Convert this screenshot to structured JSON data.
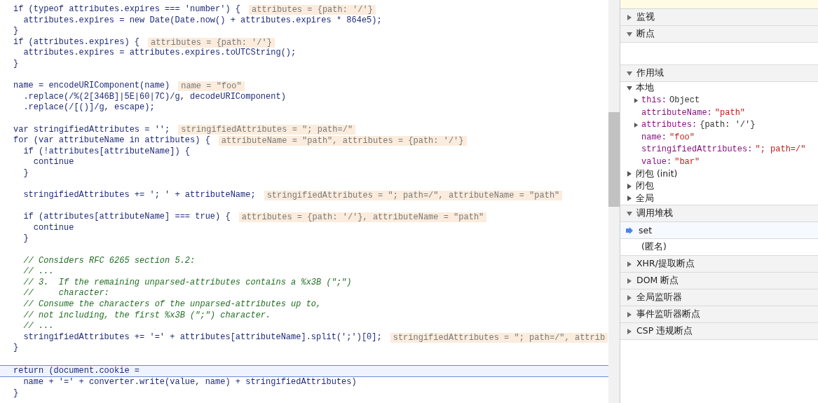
{
  "code_lines": [
    {
      "kind": "code",
      "text": "if (typeof attributes.expires === 'number') {",
      "inline_value": "attributes = {path: '/'}",
      "current": false
    },
    {
      "kind": "code",
      "text": "  attributes.expires = new Date(Date.now() + attributes.expires * 864e5);",
      "current": false
    },
    {
      "kind": "code",
      "text": "}",
      "current": false
    },
    {
      "kind": "code",
      "text": "if (attributes.expires) {",
      "inline_value": "attributes = {path: '/'}",
      "current": false
    },
    {
      "kind": "code",
      "text": "  attributes.expires = attributes.expires.toUTCString();",
      "current": false
    },
    {
      "kind": "code",
      "text": "}",
      "current": false
    },
    {
      "kind": "blank",
      "current": false
    },
    {
      "kind": "code",
      "text": "name = encodeURIComponent(name)",
      "inline_value": "name = \"foo\"",
      "current": false
    },
    {
      "kind": "code",
      "text": "  .replace(/%(2[346B]|5E|60|7C)/g, decodeURIComponent)",
      "current": false
    },
    {
      "kind": "code",
      "text": "  .replace(/[()]/g, escape);",
      "current": false
    },
    {
      "kind": "blank",
      "current": false
    },
    {
      "kind": "code",
      "text": "var stringifiedAttributes = '';",
      "inline_value": "stringifiedAttributes = \"; path=/\"",
      "current": false
    },
    {
      "kind": "code",
      "text": "for (var attributeName in attributes) {",
      "inline_value": "attributeName = \"path\", attributes = {path: '/'}",
      "current": false
    },
    {
      "kind": "code",
      "text": "  if (!attributes[attributeName]) {",
      "current": false
    },
    {
      "kind": "code",
      "text": "    continue",
      "current": false
    },
    {
      "kind": "code",
      "text": "  }",
      "current": false
    },
    {
      "kind": "blank",
      "current": false
    },
    {
      "kind": "code",
      "text": "  stringifiedAttributes += '; ' + attributeName;",
      "inline_value": "stringifiedAttributes = \"; path=/\", attributeName = \"path\"",
      "current": false
    },
    {
      "kind": "blank",
      "current": false
    },
    {
      "kind": "code",
      "text": "  if (attributes[attributeName] === true) {",
      "inline_value": "attributes = {path: '/'}, attributeName = \"path\"",
      "current": false
    },
    {
      "kind": "code",
      "text": "    continue",
      "current": false
    },
    {
      "kind": "code",
      "text": "  }",
      "current": false
    },
    {
      "kind": "blank",
      "current": false
    },
    {
      "kind": "comment",
      "text": "  // Considers RFC 6265 section 5.2:",
      "current": false
    },
    {
      "kind": "comment",
      "text": "  // ...",
      "current": false
    },
    {
      "kind": "comment",
      "text": "  // 3.  If the remaining unparsed-attributes contains a %x3B (\";\")",
      "current": false
    },
    {
      "kind": "comment",
      "text": "  //     character:",
      "current": false
    },
    {
      "kind": "comment",
      "text": "  // Consume the characters of the unparsed-attributes up to,",
      "current": false
    },
    {
      "kind": "comment",
      "text": "  // not including, the first %x3B (\";\") character.",
      "current": false
    },
    {
      "kind": "comment",
      "text": "  // ...",
      "current": false
    },
    {
      "kind": "code",
      "text": "  stringifiedAttributes += '=' + attributes[attributeName].split(';')[0];",
      "inline_value": "stringifiedAttributes = \"; path=/\", attrib",
      "current": false
    },
    {
      "kind": "code",
      "text": "}",
      "current": false
    },
    {
      "kind": "blank",
      "current": false
    },
    {
      "kind": "code",
      "text": "return (document.cookie =",
      "current": true
    },
    {
      "kind": "code",
      "text": "  name + '=' + converter.write(value, name) + stringifiedAttributes)",
      "current": false
    },
    {
      "kind": "code",
      "text": "}",
      "current": false
    }
  ],
  "sidebar": {
    "sections": [
      {
        "kind": "header",
        "title": "监视",
        "expanded": false
      },
      {
        "kind": "header",
        "title": "断点",
        "expanded": true
      },
      {
        "kind": "empty"
      },
      {
        "kind": "header",
        "title": "作用域",
        "expanded": true
      },
      {
        "kind": "scope",
        "title": "本地",
        "expanded": true,
        "properties": [
          {
            "name": "this:",
            "value": "Object",
            "color": "#333333",
            "expandable": true
          },
          {
            "name": "attributeName:",
            "value": "\"path\"",
            "color": "#c41a16",
            "expandable": false
          },
          {
            "name": "attributes:",
            "value": "{path: '/'}",
            "color": "#333333",
            "expandable": true
          },
          {
            "name": "name:",
            "value": "\"foo\"",
            "color": "#c41a16",
            "expandable": false
          },
          {
            "name": "stringifiedAttributes:",
            "value": "\"; path=/\"",
            "color": "#c41a16",
            "expandable": false
          },
          {
            "name": "value:",
            "value": "\"bar\"",
            "color": "#c41a16",
            "expandable": false
          }
        ]
      },
      {
        "kind": "scope",
        "title": "闭包 (init)",
        "expanded": false
      },
      {
        "kind": "scope",
        "title": "闭包",
        "expanded": false
      },
      {
        "kind": "scope",
        "title": "全局",
        "expanded": false
      },
      {
        "kind": "header",
        "title": "调用堆栈",
        "expanded": true
      },
      {
        "kind": "frame",
        "title": "set",
        "current": true
      },
      {
        "kind": "frame",
        "title": "(匿名)",
        "current": false
      },
      {
        "kind": "header",
        "title": "XHR/提取断点",
        "expanded": false
      },
      {
        "kind": "header",
        "title": "DOM 断点",
        "expanded": false
      },
      {
        "kind": "header",
        "title": "全局监听器",
        "expanded": false
      },
      {
        "kind": "header",
        "title": "事件监听器断点",
        "expanded": false
      },
      {
        "kind": "header",
        "title": "CSP 违规断点",
        "expanded": false
      }
    ]
  }
}
